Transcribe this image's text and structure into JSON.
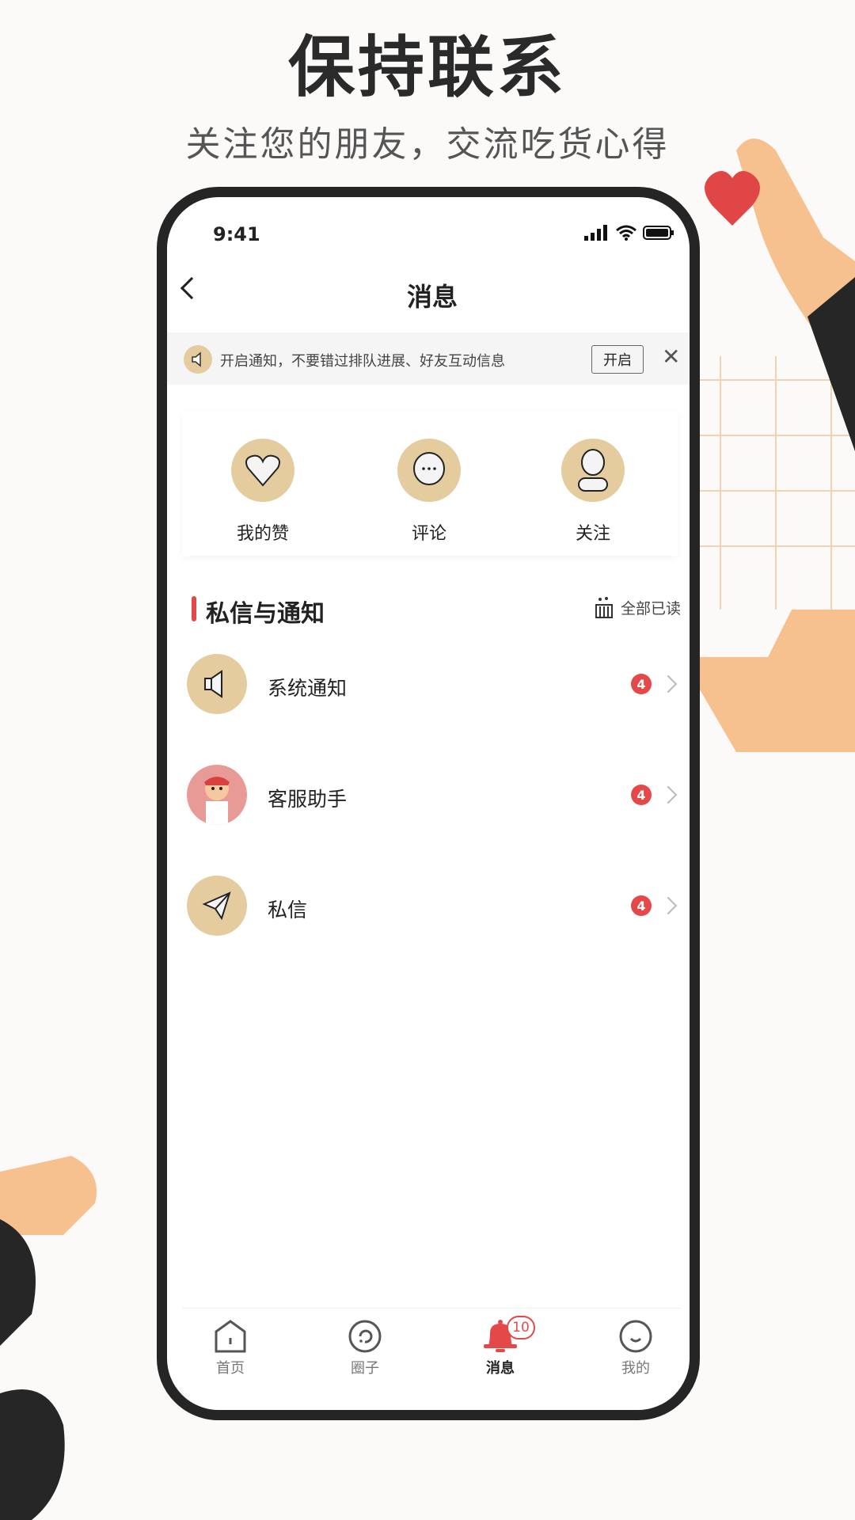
{
  "hero": {
    "title": "保持联系",
    "subtitle": "关注您的朋友，交流吃货心得"
  },
  "status_bar": {
    "time": "9:41"
  },
  "header": {
    "title": "消息"
  },
  "banner": {
    "text": "开启通知，不要错过排队进展、好友互动信息",
    "button": "开启"
  },
  "quick_actions": [
    {
      "label": "我的赞",
      "icon": "heart-icon"
    },
    {
      "label": "评论",
      "icon": "comment-icon"
    },
    {
      "label": "关注",
      "icon": "user-icon"
    }
  ],
  "section": {
    "title": "私信与通知",
    "mark_all_read": "全部已读"
  },
  "messages": [
    {
      "label": "系统通知",
      "badge": "4",
      "icon": "speaker-icon"
    },
    {
      "label": "客服助手",
      "badge": "4",
      "icon": "mascot-avatar"
    },
    {
      "label": "私信",
      "badge": "4",
      "icon": "paper-plane-icon"
    }
  ],
  "tabs": [
    {
      "label": "首页",
      "icon": "home-icon"
    },
    {
      "label": "圈子",
      "icon": "circle-icon"
    },
    {
      "label": "消息",
      "icon": "bell-icon",
      "badge": "10",
      "active": true
    },
    {
      "label": "我的",
      "icon": "smile-icon"
    }
  ],
  "colors": {
    "accent": "#e54848",
    "icon_bg": "#e5cc9f"
  }
}
